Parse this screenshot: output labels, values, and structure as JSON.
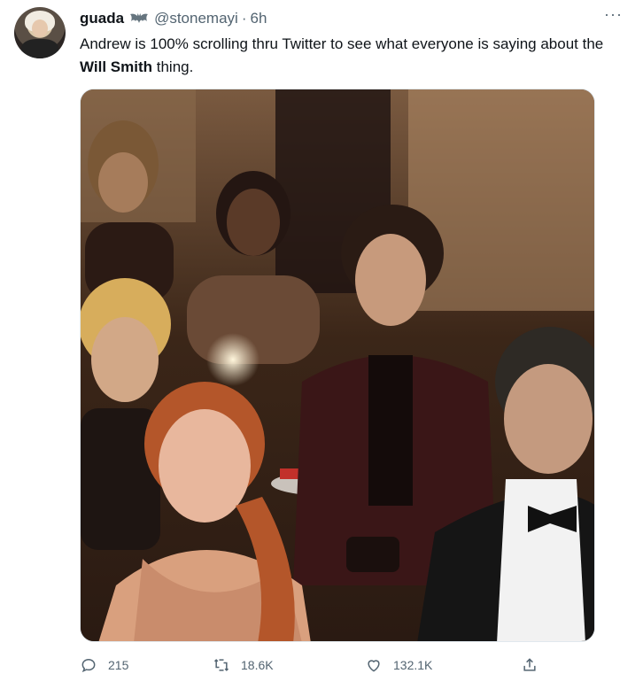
{
  "tweet": {
    "display_name": "guada",
    "handle": "@stonemayi",
    "separator": "·",
    "time": "6h",
    "more_label": "···",
    "text_before": "Andrew is 100% scrolling thru Twitter to see what everyone is saying about the ",
    "text_bold": "Will Smith",
    "text_after": " thing."
  },
  "actions": {
    "replies": "215",
    "retweets": "18.6K",
    "likes": "132.1K"
  },
  "icons": {
    "avatar": "avatar-photo",
    "badge": "bat-emoji-icon",
    "reply": "reply-icon",
    "retweet": "retweet-icon",
    "like": "heart-icon",
    "share": "share-icon"
  },
  "colors": {
    "text": "#0f1419",
    "secondary": "#536471"
  }
}
